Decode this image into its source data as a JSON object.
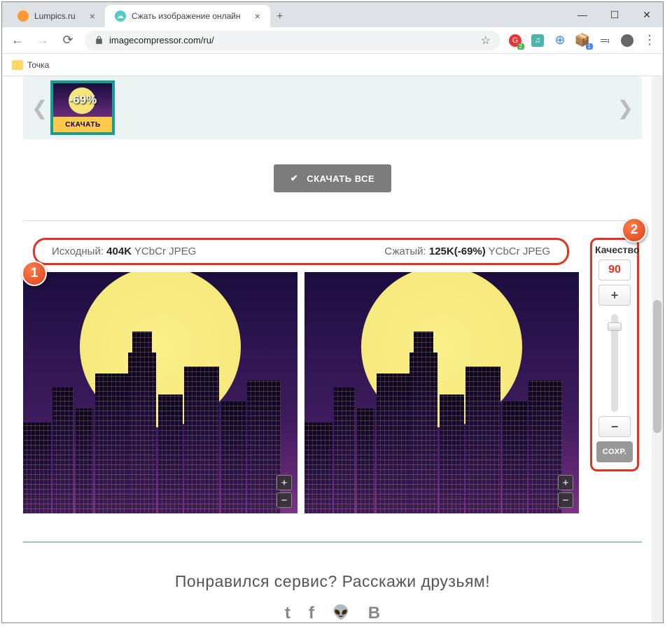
{
  "tabs": [
    {
      "title": "Lumpics.ru"
    },
    {
      "title": "Сжать изображение онлайн"
    }
  ],
  "url": "imagecompressor.com/ru/",
  "bookmarks": {
    "folder1": "Точка"
  },
  "carousel": {
    "thumb_percent": "-69%",
    "download_btn": "СКАЧАТЬ"
  },
  "download_all": "СКАЧАТЬ ВСЕ",
  "info": {
    "original_label": "Исходный: ",
    "original_size": "404K",
    "original_fmt": " YCbCr JPEG",
    "compressed_label": "Сжатый: ",
    "compressed_size": "125K(-69%)",
    "compressed_fmt": " YCbCr JPEG"
  },
  "quality": {
    "title": "Качество",
    "value": "90",
    "plus": "+",
    "minus": "−",
    "save": "СОХР."
  },
  "zoom": {
    "in": "+",
    "out": "−"
  },
  "footer": {
    "title": "Понравился сервис? Расскажи друзьям!"
  },
  "callouts": {
    "c1": "1",
    "c2": "2"
  }
}
